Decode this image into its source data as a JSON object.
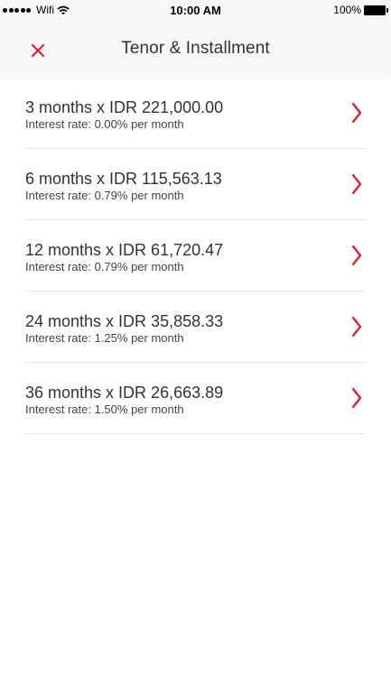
{
  "status_bar": {
    "carrier": "Wifi",
    "time": "10:00 AM",
    "battery": "100%"
  },
  "header": {
    "title": "Tenor & Installment",
    "close_icon": "close-icon"
  },
  "colors": {
    "accent": "#e0202a",
    "text": "#333333",
    "divider": "#e6e6e6",
    "header_bg": "#f7f7f7"
  },
  "tenor_options": [
    {
      "title": "3 months x IDR 221,000.00",
      "subtitle": "Interest rate: 0.00% per month"
    },
    {
      "title": "6 months x IDR 115,563.13",
      "subtitle": "Interest rate: 0.79% per month"
    },
    {
      "title": "12 months x IDR 61,720.47",
      "subtitle": "Interest rate: 0.79% per month"
    },
    {
      "title": "24 months x IDR 35,858.33",
      "subtitle": "Interest rate: 1.25% per month"
    },
    {
      "title": "36 months x IDR 26,663.89",
      "subtitle": "Interest rate: 1.50% per month"
    }
  ]
}
